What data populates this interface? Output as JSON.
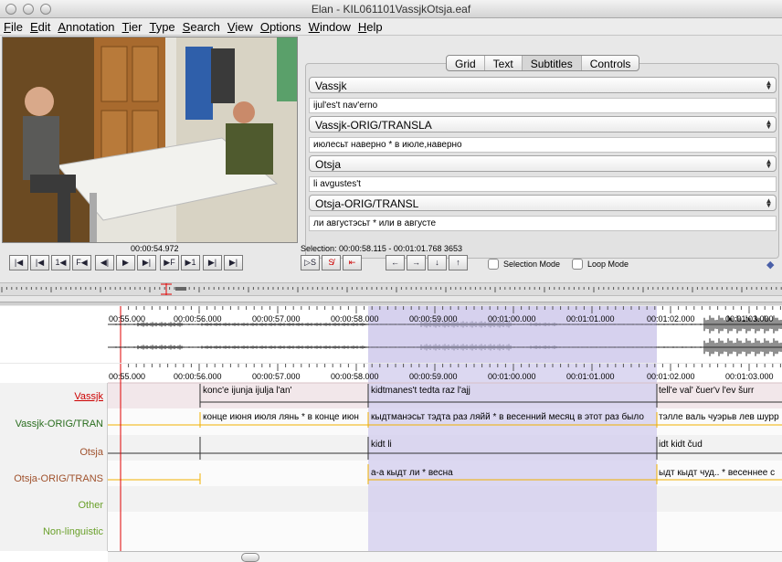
{
  "window": {
    "title": "Elan - KIL061101VassjkOtsja.eaf"
  },
  "menu": [
    "File",
    "Edit",
    "Annotation",
    "Tier",
    "Type",
    "Search",
    "View",
    "Options",
    "Window",
    "Help"
  ],
  "tabs": [
    "Grid",
    "Text",
    "Subtitles",
    "Controls"
  ],
  "subtitles": [
    {
      "tier": "Vassjk",
      "text": "ijul'es't nav'erno"
    },
    {
      "tier": "Vassjk-ORIG/TRANSLA",
      "text": "июлесьт наверно * в июле,наверно"
    },
    {
      "tier": "Otsja",
      "text": "li avgustes't"
    },
    {
      "tier": "Otsja-ORIG/TRANSL",
      "text": "ли августэсьт * или в августе"
    }
  ],
  "player": {
    "timecode": "00:00:54.972",
    "selection": "Selection: 00:00:58.115 - 00:01:01.768  3653",
    "buttons": [
      "|◀",
      "|◀",
      "1◀",
      "F◀",
      "◀|",
      "▶",
      "▶|",
      "▶F",
      "▶1",
      "▶|",
      "▶|"
    ],
    "selection_buttons": [
      "▷S",
      "S̸",
      "⇤"
    ],
    "nav_buttons": [
      "←",
      "→",
      "↓",
      "↑"
    ],
    "selection_mode": "Selection Mode",
    "loop_mode": "Loop Mode"
  },
  "timeline": {
    "ticks": [
      "00:55.000",
      "00:00:56.000",
      "00:00:57.000",
      "00:00:58.000",
      "00:00:59.000",
      "00:01:00.000",
      "00:01:01.000",
      "00:01:02.000",
      "00:01:03.000"
    ]
  },
  "tiers": [
    {
      "name": "Vassjk",
      "color": "#cc0000",
      "annotations": [
        "konc'e ijunja ijulja l'an'",
        "kidtmanes't tedta raz l'ajj",
        "tell'e val' čuer'v l'ev šurr"
      ]
    },
    {
      "name": "Vassjk-ORIG/TRAN",
      "color": "#2a6e1f",
      "annotations": [
        "конце июня июля лянь * в конце июн",
        "кыдтманэсьт тэдта раз ляйй * в весенний месяц в этот раз было",
        "тэлле валь чуэрьв лев шурр"
      ]
    },
    {
      "name": "Otsja",
      "color": "#a0522d",
      "annotations": [
        "kidt li",
        "idt kidt čud"
      ]
    },
    {
      "name": "Otsja-ORIG/TRANS",
      "color": "#a0522d",
      "annotations": [
        "а-а кыдт ли * весна",
        "ыдт кыдт чуд.. * весеннее с"
      ]
    },
    {
      "name": "Other",
      "color": "#6aa02a",
      "annotations": []
    },
    {
      "name": "Non-linguistic",
      "color": "#6aa02a",
      "annotations": []
    }
  ],
  "colors": {
    "selection": "#d6d1ee",
    "cursor": "#e00000",
    "boundary": "#f0b000"
  }
}
